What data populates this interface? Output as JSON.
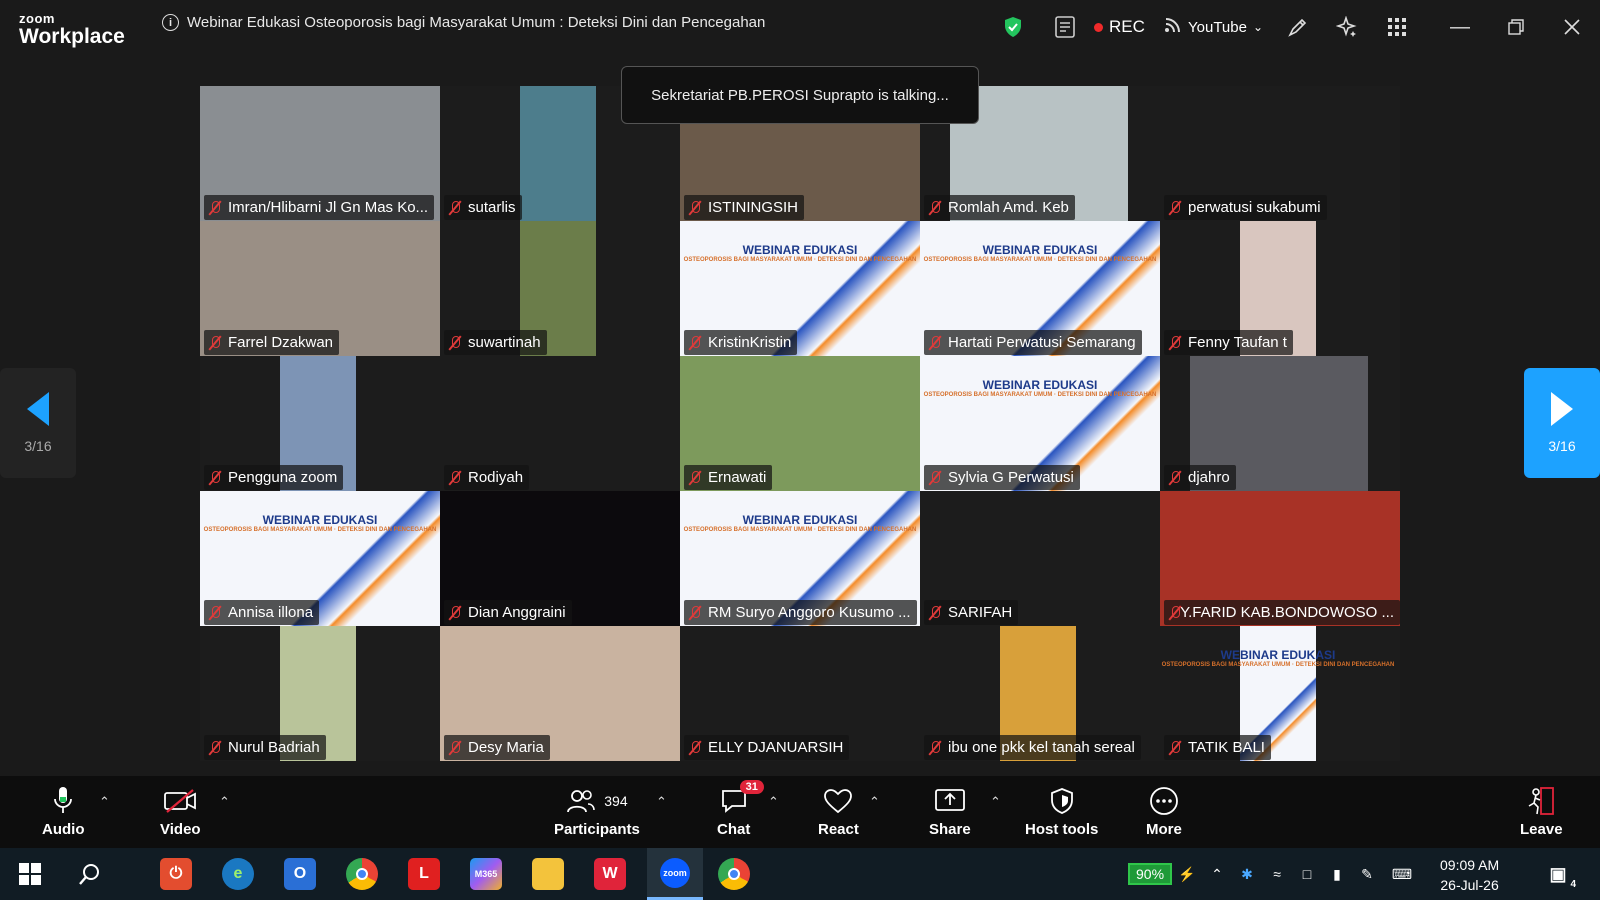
{
  "app": {
    "logo_top": "zoom",
    "logo_bottom": "Workplace"
  },
  "meeting": {
    "title": "Webinar Edukasi Osteoporosis bagi Masyarakat Umum : Deteksi Dini dan Pencegahan"
  },
  "titlebar": {
    "rec_label": "REC",
    "stream_label": "YouTube"
  },
  "toast": {
    "text": "Sekretariat PB.PEROSI Suprapto is talking..."
  },
  "pager": {
    "left_label": "3/16",
    "right_label": "3/16"
  },
  "banner": {
    "title_line1": "WEBINAR EDUKASI",
    "subtitle": "OSTEOPOROSIS BAGI MASYARAKAT UMUM · DETEKSI DINI DAN PENCEGAHAN"
  },
  "participants": [
    {
      "name": "Imran/Hlibarni Jl Gn Mas Ko...",
      "bg": "#8a8e92",
      "vid": "full"
    },
    {
      "name": "sutarlis",
      "bg": "#4d7d8c",
      "vid": "narrow"
    },
    {
      "name": "ISTININGSIH",
      "bg": "#6b5a4a",
      "vid": "full"
    },
    {
      "name": "Romlah Amd. Keb",
      "bg": "#b8c2c4",
      "vid": "wide"
    },
    {
      "name": "perwatusi sukabumi",
      "bg": "#141414",
      "vid": "none"
    },
    {
      "name": "Farrel Dzakwan",
      "bg": "#9a8f85",
      "vid": "full"
    },
    {
      "name": "suwartinah",
      "bg": "#6b7d4a",
      "vid": "narrow"
    },
    {
      "name": "KristinKristin",
      "bg": "banner",
      "vid": "full"
    },
    {
      "name": "Hartati Perwatusi Semarang",
      "bg": "banner",
      "vid": "full"
    },
    {
      "name": "Fenny Taufan t",
      "bg": "#d9c6bf",
      "vid": "narrow"
    },
    {
      "name": "Pengguna zoom",
      "bg": "#7d94b5",
      "vid": "narrow"
    },
    {
      "name": "Rodiyah",
      "bg": "#1c1c1c",
      "vid": "none"
    },
    {
      "name": "Ernawati",
      "bg": "#7d9a5c",
      "vid": "full"
    },
    {
      "name": "Sylvia G Perwatusi",
      "bg": "banner",
      "vid": "full"
    },
    {
      "name": "djahro",
      "bg": "#5a5a60",
      "vid": "wide"
    },
    {
      "name": "Annisa illona",
      "bg": "banner",
      "vid": "full"
    },
    {
      "name": "Dian Anggraini",
      "bg": "#0c0a0d",
      "vid": "full"
    },
    {
      "name": "RM Suryo Anggoro Kusumo ...",
      "bg": "banner",
      "vid": "full"
    },
    {
      "name": "SARIFAH",
      "bg": "#1c1c1c",
      "vid": "none"
    },
    {
      "name": "Y.FARID KAB.BONDOWOSO ...",
      "bg": "#a83226",
      "vid": "full"
    },
    {
      "name": "Nurul Badriah",
      "bg": "#b9c49a",
      "vid": "narrow"
    },
    {
      "name": "Desy Maria",
      "bg": "#c9b3a0",
      "vid": "full"
    },
    {
      "name": "ELLY DJANUARSIH",
      "bg": "#1c1c1c",
      "vid": "none"
    },
    {
      "name": "ibu one pkk kel tanah sereal",
      "bg": "#d8a03a",
      "vid": "narrow"
    },
    {
      "name": "TATIK BALI",
      "bg": "banner",
      "vid": "narrow"
    }
  ],
  "toolbar": {
    "audio": "Audio",
    "video": "Video",
    "participants": "Participants",
    "participants_count": "394",
    "chat": "Chat",
    "chat_badge": "31",
    "react": "React",
    "share": "Share",
    "host_tools": "Host tools",
    "more": "More",
    "leave": "Leave"
  },
  "taskbar": {
    "battery": "90%",
    "time": "09:09 AM",
    "date": "26-Jul-26",
    "notifications": "4"
  }
}
